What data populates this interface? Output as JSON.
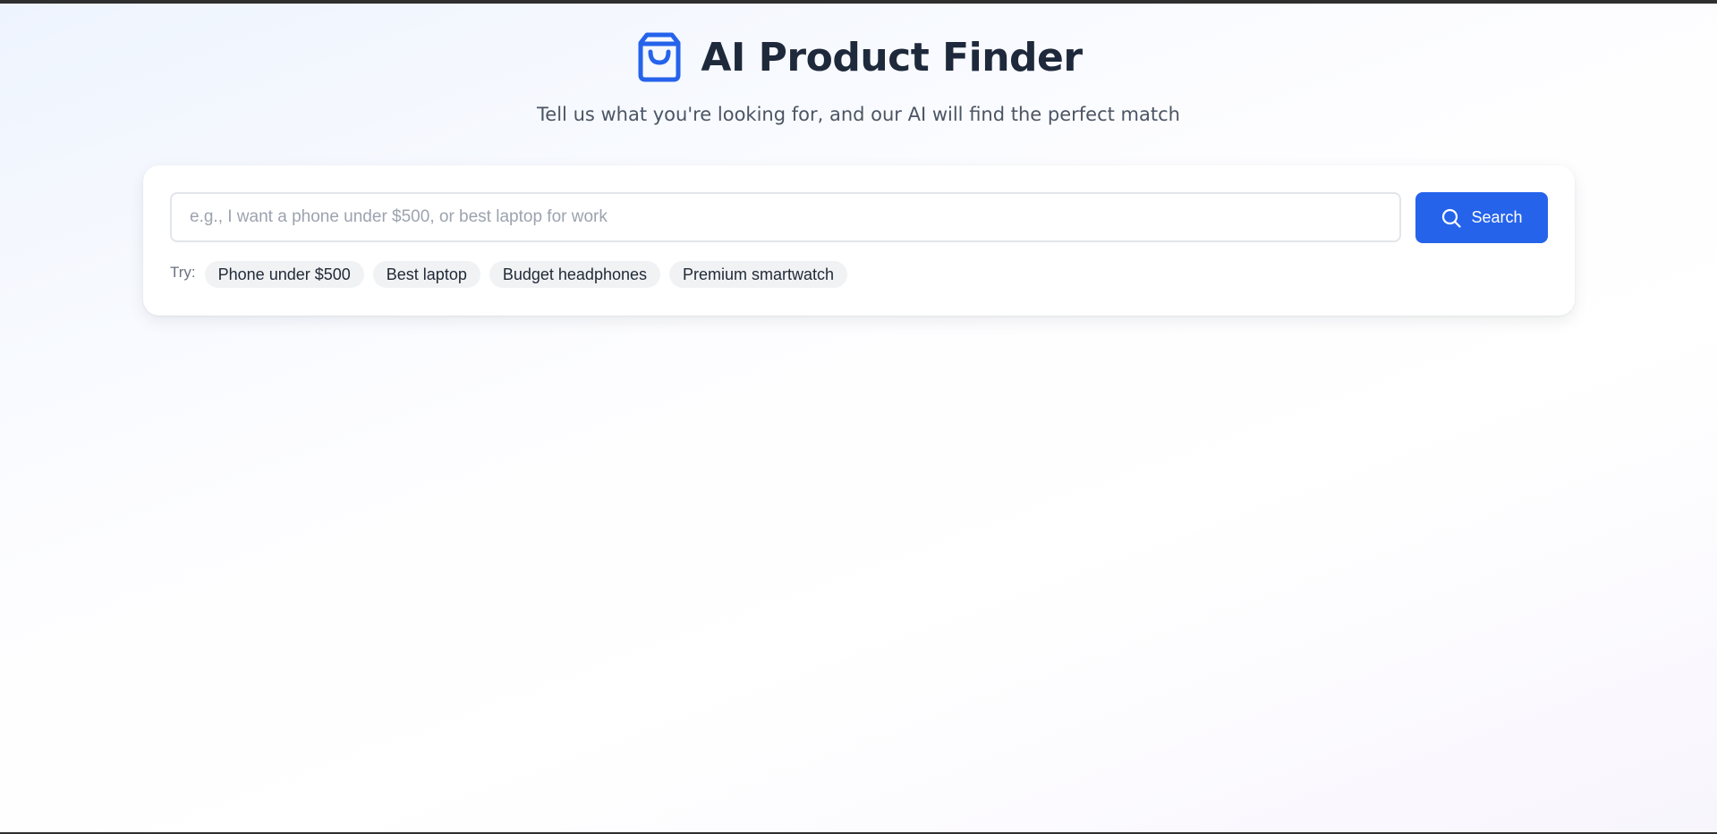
{
  "header": {
    "title": "AI Product Finder",
    "subtitle": "Tell us what you're looking for, and our AI will find the perfect match",
    "icon": "shopping-bag-icon"
  },
  "search": {
    "placeholder": "e.g., I want a phone under $500, or best laptop for work",
    "value": "",
    "button_label": "Search",
    "button_icon": "search-icon"
  },
  "suggestions": {
    "label": "Try:",
    "items": [
      "Phone under $500",
      "Best laptop",
      "Budget headphones",
      "Premium smartwatch"
    ]
  },
  "colors": {
    "accent": "#2563eb",
    "title": "#1e293b",
    "subtitle": "#4b5563",
    "chip_background": "#f1f2f4"
  }
}
